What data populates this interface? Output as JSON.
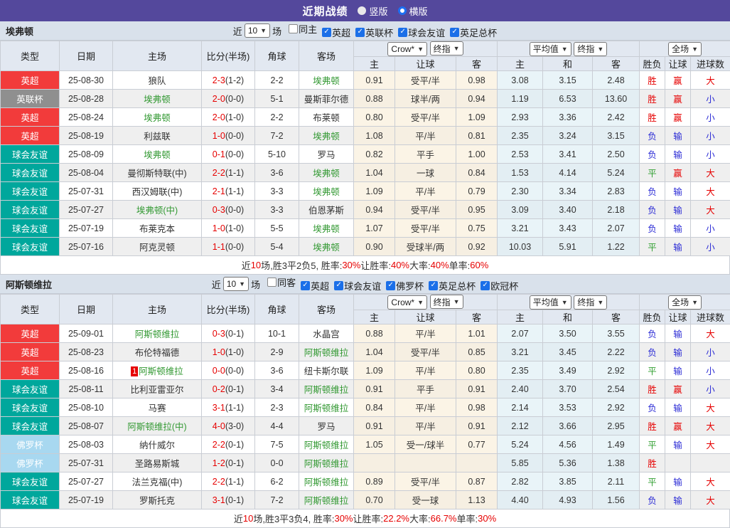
{
  "colors": {
    "topbar": "#54489c",
    "league_premier_red": "#f23b3b",
    "league_cup_gray": "#8f8f8f",
    "league_friendly_teal": "#00a79c",
    "league_florida_lightblue": "#a8d8f0",
    "team_highlight_green": "#339933",
    "score_red": "#e60000",
    "win_red": "#e60000",
    "draw_green": "#2f9e2f",
    "lose_blue": "#2b2bd5",
    "crow_column_bg": "#fbf4e6",
    "avg_column_bg": "#e9f4f8"
  },
  "topbar": {
    "title": "近期战绩",
    "radios": [
      {
        "label": "竖版",
        "selected": false
      },
      {
        "label": "横版",
        "selected": true
      }
    ]
  },
  "columns": {
    "type": "类型",
    "date": "日期",
    "home": "主场",
    "score": "比分(半场)",
    "corner": "角球",
    "away": "客场",
    "odds_home": "主",
    "odds_handicap": "让球",
    "odds_away": "客",
    "avg_home": "主",
    "avg_draw": "和",
    "avg_away": "客",
    "wdl": "胜负",
    "handicap_result": "让球",
    "goals": "进球数"
  },
  "selects": {
    "count": "10",
    "crow": "Crow*",
    "final": "终指",
    "avg": "平均值",
    "full": "全场"
  },
  "sections": [
    {
      "team": "埃弗顿",
      "filter": {
        "prefix": "近",
        "count": "10",
        "suffix": "场",
        "items": [
          {
            "label": "同主",
            "checked": false
          },
          {
            "label": "英超",
            "checked": true
          },
          {
            "label": "英联杯",
            "checked": true
          },
          {
            "label": "球会友谊",
            "checked": true
          },
          {
            "label": "英足总杯",
            "checked": true
          }
        ]
      },
      "rows": [
        {
          "type": {
            "label": "英超",
            "color": "red"
          },
          "date": "25-08-30",
          "home": {
            "name": "狼队"
          },
          "score": {
            "main": "2-3",
            "half": "(1-2)"
          },
          "corner": "2-2",
          "away": {
            "name": "埃弗顿",
            "hl": true
          },
          "crow": [
            "0.91",
            "受平/半",
            "0.98"
          ],
          "avg": [
            "3.08",
            "3.15",
            "2.48"
          ],
          "res": [
            [
              "胜",
              "r"
            ],
            [
              "赢",
              "r"
            ],
            [
              "大",
              "r"
            ]
          ]
        },
        {
          "type": {
            "label": "英联杯",
            "color": "gray"
          },
          "date": "25-08-28",
          "home": {
            "name": "埃弗顿",
            "hl": true
          },
          "score": {
            "main": "2-0",
            "half": "(0-0)"
          },
          "corner": "5-1",
          "away": {
            "name": "曼斯菲尔德"
          },
          "crow": [
            "0.88",
            "球半/两",
            "0.94"
          ],
          "avg": [
            "1.19",
            "6.53",
            "13.60"
          ],
          "res": [
            [
              "胜",
              "r"
            ],
            [
              "赢",
              "r"
            ],
            [
              "小",
              "b"
            ]
          ]
        },
        {
          "type": {
            "label": "英超",
            "color": "red"
          },
          "date": "25-08-24",
          "home": {
            "name": "埃弗顿",
            "hl": true
          },
          "score": {
            "main": "2-0",
            "half": "(1-0)"
          },
          "corner": "2-2",
          "away": {
            "name": "布莱顿"
          },
          "crow": [
            "0.80",
            "受平/半",
            "1.09"
          ],
          "avg": [
            "2.93",
            "3.36",
            "2.42"
          ],
          "res": [
            [
              "胜",
              "r"
            ],
            [
              "赢",
              "r"
            ],
            [
              "小",
              "b"
            ]
          ]
        },
        {
          "type": {
            "label": "英超",
            "color": "red"
          },
          "date": "25-08-19",
          "home": {
            "name": "利兹联"
          },
          "score": {
            "main": "1-0",
            "half": "(0-0)"
          },
          "corner": "7-2",
          "away": {
            "name": "埃弗顿",
            "hl": true
          },
          "crow": [
            "1.08",
            "平/半",
            "0.81"
          ],
          "avg": [
            "2.35",
            "3.24",
            "3.15"
          ],
          "res": [
            [
              "负",
              "b"
            ],
            [
              "输",
              "b"
            ],
            [
              "小",
              "b"
            ]
          ]
        },
        {
          "type": {
            "label": "球会友谊",
            "color": "teal"
          },
          "date": "25-08-09",
          "home": {
            "name": "埃弗顿",
            "hl": true
          },
          "score": {
            "main": "0-1",
            "half": "(0-0)"
          },
          "corner": "5-10",
          "away": {
            "name": "罗马"
          },
          "crow": [
            "0.82",
            "平手",
            "1.00"
          ],
          "avg": [
            "2.53",
            "3.41",
            "2.50"
          ],
          "res": [
            [
              "负",
              "b"
            ],
            [
              "输",
              "b"
            ],
            [
              "小",
              "b"
            ]
          ]
        },
        {
          "type": {
            "label": "球会友谊",
            "color": "teal"
          },
          "date": "25-08-04",
          "home": {
            "name": "曼彻斯特联(中)"
          },
          "score": {
            "main": "2-2",
            "half": "(1-1)"
          },
          "corner": "3-6",
          "away": {
            "name": "埃弗顿",
            "hl": true
          },
          "crow": [
            "1.04",
            "一球",
            "0.84"
          ],
          "avg": [
            "1.53",
            "4.14",
            "5.24"
          ],
          "res": [
            [
              "平",
              "g"
            ],
            [
              "赢",
              "r"
            ],
            [
              "大",
              "r"
            ]
          ]
        },
        {
          "type": {
            "label": "球会友谊",
            "color": "teal"
          },
          "date": "25-07-31",
          "home": {
            "name": "西汉姆联(中)"
          },
          "score": {
            "main": "2-1",
            "half": "(1-1)"
          },
          "corner": "3-3",
          "away": {
            "name": "埃弗顿",
            "hl": true
          },
          "crow": [
            "1.09",
            "平/半",
            "0.79"
          ],
          "avg": [
            "2.30",
            "3.34",
            "2.83"
          ],
          "res": [
            [
              "负",
              "b"
            ],
            [
              "输",
              "b"
            ],
            [
              "大",
              "r"
            ]
          ]
        },
        {
          "type": {
            "label": "球会友谊",
            "color": "teal"
          },
          "date": "25-07-27",
          "home": {
            "name": "埃弗顿(中)",
            "hl": true
          },
          "score": {
            "main": "0-3",
            "half": "(0-0)"
          },
          "corner": "3-3",
          "away": {
            "name": "伯恩茅斯"
          },
          "crow": [
            "0.94",
            "受平/半",
            "0.95"
          ],
          "avg": [
            "3.09",
            "3.40",
            "2.18"
          ],
          "res": [
            [
              "负",
              "b"
            ],
            [
              "输",
              "b"
            ],
            [
              "大",
              "r"
            ]
          ]
        },
        {
          "type": {
            "label": "球会友谊",
            "color": "teal"
          },
          "date": "25-07-19",
          "home": {
            "name": "布莱克本"
          },
          "score": {
            "main": "1-0",
            "half": "(1-0)"
          },
          "corner": "5-5",
          "away": {
            "name": "埃弗顿",
            "hl": true
          },
          "crow": [
            "1.07",
            "受平/半",
            "0.75"
          ],
          "avg": [
            "3.21",
            "3.43",
            "2.07"
          ],
          "res": [
            [
              "负",
              "b"
            ],
            [
              "输",
              "b"
            ],
            [
              "小",
              "b"
            ]
          ]
        },
        {
          "type": {
            "label": "球会友谊",
            "color": "teal"
          },
          "date": "25-07-16",
          "home": {
            "name": "阿克灵顿"
          },
          "score": {
            "main": "1-1",
            "half": "(0-0)"
          },
          "corner": "5-4",
          "away": {
            "name": "埃弗顿",
            "hl": true
          },
          "crow": [
            "0.90",
            "受球半/两",
            "0.92"
          ],
          "avg": [
            "10.03",
            "5.91",
            "1.22"
          ],
          "res": [
            [
              "平",
              "g"
            ],
            [
              "输",
              "b"
            ],
            [
              "小",
              "b"
            ]
          ]
        }
      ],
      "summary": [
        {
          "t": "近"
        },
        {
          "t": "10",
          "red": true
        },
        {
          "t": "场,胜3平2负5, 胜率:"
        },
        {
          "t": "30%",
          "red": true
        },
        {
          "t": " 让胜率:"
        },
        {
          "t": "40%",
          "red": true
        },
        {
          "t": " 大率:"
        },
        {
          "t": "40%",
          "red": true
        },
        {
          "t": " 单率:"
        },
        {
          "t": "60%",
          "red": true
        }
      ]
    },
    {
      "team": "阿斯顿维拉",
      "filter": {
        "prefix": "近",
        "count": "10",
        "suffix": "场",
        "items": [
          {
            "label": "同客",
            "checked": false
          },
          {
            "label": "英超",
            "checked": true
          },
          {
            "label": "球会友谊",
            "checked": true
          },
          {
            "label": "佛罗杯",
            "checked": true
          },
          {
            "label": "英足总杯",
            "checked": true
          },
          {
            "label": "欧冠杯",
            "checked": true
          }
        ]
      },
      "rows": [
        {
          "type": {
            "label": "英超",
            "color": "red"
          },
          "date": "25-09-01",
          "home": {
            "name": "阿斯顿维拉",
            "hl": true
          },
          "score": {
            "main": "0-3",
            "half": "(0-1)"
          },
          "corner": "10-1",
          "away": {
            "name": "水晶宫"
          },
          "crow": [
            "0.88",
            "平/半",
            "1.01"
          ],
          "avg": [
            "2.07",
            "3.50",
            "3.55"
          ],
          "res": [
            [
              "负",
              "b"
            ],
            [
              "输",
              "b"
            ],
            [
              "大",
              "r"
            ]
          ]
        },
        {
          "type": {
            "label": "英超",
            "color": "red"
          },
          "date": "25-08-23",
          "home": {
            "name": "布伦特福德"
          },
          "score": {
            "main": "1-0",
            "half": "(1-0)"
          },
          "corner": "2-9",
          "away": {
            "name": "阿斯顿维拉",
            "hl": true
          },
          "crow": [
            "1.04",
            "受平/半",
            "0.85"
          ],
          "avg": [
            "3.21",
            "3.45",
            "2.22"
          ],
          "res": [
            [
              "负",
              "b"
            ],
            [
              "输",
              "b"
            ],
            [
              "小",
              "b"
            ]
          ]
        },
        {
          "type": {
            "label": "英超",
            "color": "red"
          },
          "date": "25-08-16",
          "home": {
            "name": "阿斯顿维拉",
            "hl": true,
            "badge": "1"
          },
          "score": {
            "main": "0-0",
            "half": "(0-0)"
          },
          "corner": "3-6",
          "away": {
            "name": "纽卡斯尔联"
          },
          "crow": [
            "1.09",
            "平/半",
            "0.80"
          ],
          "avg": [
            "2.35",
            "3.49",
            "2.92"
          ],
          "res": [
            [
              "平",
              "g"
            ],
            [
              "输",
              "b"
            ],
            [
              "小",
              "b"
            ]
          ]
        },
        {
          "type": {
            "label": "球会友谊",
            "color": "teal"
          },
          "date": "25-08-11",
          "home": {
            "name": "比利亚雷亚尔"
          },
          "score": {
            "main": "0-2",
            "half": "(0-1)"
          },
          "corner": "3-4",
          "away": {
            "name": "阿斯顿维拉",
            "hl": true
          },
          "crow": [
            "0.91",
            "平手",
            "0.91"
          ],
          "avg": [
            "2.40",
            "3.70",
            "2.54"
          ],
          "res": [
            [
              "胜",
              "r"
            ],
            [
              "赢",
              "r"
            ],
            [
              "小",
              "b"
            ]
          ]
        },
        {
          "type": {
            "label": "球会友谊",
            "color": "teal"
          },
          "date": "25-08-10",
          "home": {
            "name": "马赛"
          },
          "score": {
            "main": "3-1",
            "half": "(1-1)"
          },
          "corner": "2-3",
          "away": {
            "name": "阿斯顿维拉",
            "hl": true
          },
          "crow": [
            "0.84",
            "平/半",
            "0.98"
          ],
          "avg": [
            "2.14",
            "3.53",
            "2.92"
          ],
          "res": [
            [
              "负",
              "b"
            ],
            [
              "输",
              "b"
            ],
            [
              "大",
              "r"
            ]
          ]
        },
        {
          "type": {
            "label": "球会友谊",
            "color": "teal"
          },
          "date": "25-08-07",
          "home": {
            "name": "阿斯顿维拉(中)",
            "hl": true
          },
          "score": {
            "main": "4-0",
            "half": "(3-0)"
          },
          "corner": "4-4",
          "away": {
            "name": "罗马"
          },
          "crow": [
            "0.91",
            "平/半",
            "0.91"
          ],
          "avg": [
            "2.12",
            "3.66",
            "2.95"
          ],
          "res": [
            [
              "胜",
              "r"
            ],
            [
              "赢",
              "r"
            ],
            [
              "大",
              "r"
            ]
          ]
        },
        {
          "type": {
            "label": "佛罗杯",
            "color": "lblue"
          },
          "date": "25-08-03",
          "home": {
            "name": "纳什威尔"
          },
          "score": {
            "main": "2-2",
            "half": "(0-1)"
          },
          "corner": "7-5",
          "away": {
            "name": "阿斯顿维拉",
            "hl": true
          },
          "crow": [
            "1.05",
            "受一/球半",
            "0.77"
          ],
          "avg": [
            "5.24",
            "4.56",
            "1.49"
          ],
          "res": [
            [
              "平",
              "g"
            ],
            [
              "输",
              "b"
            ],
            [
              "大",
              "r"
            ]
          ]
        },
        {
          "type": {
            "label": "佛罗杯",
            "color": "lblue"
          },
          "date": "25-07-31",
          "home": {
            "name": "圣路易斯城"
          },
          "score": {
            "main": "1-2",
            "half": "(0-1)"
          },
          "corner": "0-0",
          "away": {
            "name": "阿斯顿维拉",
            "hl": true
          },
          "crow": [
            "",
            "",
            ""
          ],
          "avg": [
            "5.85",
            "5.36",
            "1.38"
          ],
          "res": [
            [
              "胜",
              "r"
            ],
            [
              "",
              ""
            ],
            [
              "",
              ""
            ]
          ]
        },
        {
          "type": {
            "label": "球会友谊",
            "color": "teal"
          },
          "date": "25-07-27",
          "home": {
            "name": "法兰克福(中)"
          },
          "score": {
            "main": "2-2",
            "half": "(1-1)"
          },
          "corner": "6-2",
          "away": {
            "name": "阿斯顿维拉",
            "hl": true
          },
          "crow": [
            "0.89",
            "受平/半",
            "0.87"
          ],
          "avg": [
            "2.82",
            "3.85",
            "2.11"
          ],
          "res": [
            [
              "平",
              "g"
            ],
            [
              "输",
              "b"
            ],
            [
              "大",
              "r"
            ]
          ]
        },
        {
          "type": {
            "label": "球会友谊",
            "color": "teal"
          },
          "date": "25-07-19",
          "home": {
            "name": "罗斯托克"
          },
          "score": {
            "main": "3-1",
            "half": "(0-1)"
          },
          "corner": "7-2",
          "away": {
            "name": "阿斯顿维拉",
            "hl": true
          },
          "crow": [
            "0.70",
            "受一球",
            "1.13"
          ],
          "avg": [
            "4.40",
            "4.93",
            "1.56"
          ],
          "res": [
            [
              "负",
              "b"
            ],
            [
              "输",
              "b"
            ],
            [
              "大",
              "r"
            ]
          ]
        }
      ],
      "summary": [
        {
          "t": "近"
        },
        {
          "t": "10",
          "red": true
        },
        {
          "t": "场,胜3平3负4, 胜率:"
        },
        {
          "t": "30%",
          "red": true
        },
        {
          "t": " 让胜率:"
        },
        {
          "t": "22.2%",
          "red": true
        },
        {
          "t": " 大率:"
        },
        {
          "t": "66.7%",
          "red": true
        },
        {
          "t": " 单率:"
        },
        {
          "t": "30%",
          "red": true
        }
      ]
    }
  ]
}
